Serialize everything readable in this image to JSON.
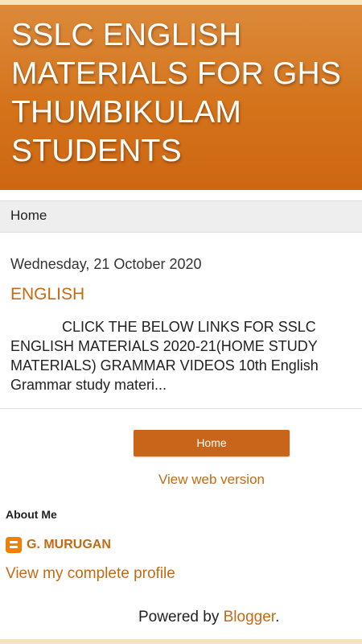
{
  "header": {
    "title": "SSLC ENGLISH MATERIALS FOR GHS THUMBIKULAM STUDENTS"
  },
  "nav": {
    "home_label": "Home"
  },
  "post": {
    "date": "Wednesday, 21 October 2020",
    "title": "ENGLISH",
    "snippet": "CLICK THE BELOW LINKS FOR SSLC ENGLISH MATERIALS 2020-21(HOME STUDY MATERIALS) GRAMMAR VIDEOS 10th English Grammar study materi..."
  },
  "footer_nav": {
    "home_button_label": "Home",
    "web_version_label": "View web version"
  },
  "about": {
    "heading": "About Me",
    "profile_icon": "blogger-icon",
    "profile_name": "G. MURUGAN",
    "complete_profile_label": "View my complete profile"
  },
  "powered_by": {
    "prefix": "Powered by ",
    "link_label": "Blogger",
    "suffix": "."
  },
  "colors": {
    "accent": "#c46a14",
    "header_bg": "#d4731b",
    "button_bg": "#c8651a",
    "strip": "#f3e3bf"
  }
}
